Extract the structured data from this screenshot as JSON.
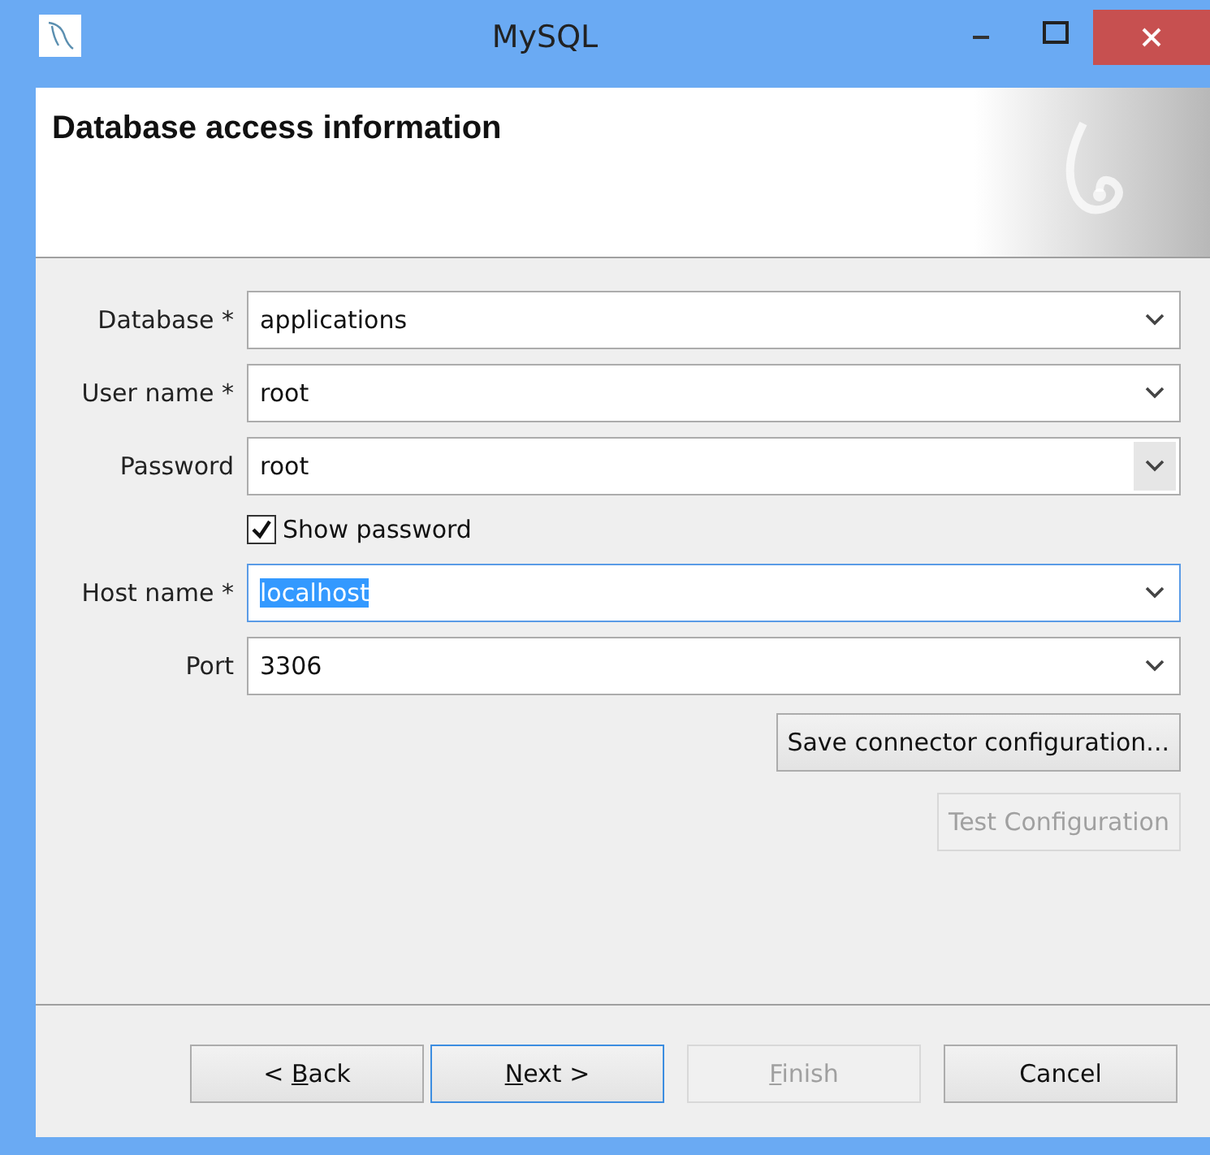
{
  "window": {
    "title": "MySQL"
  },
  "header": {
    "title": "Database access information"
  },
  "fields": [
    {
      "label": "Database *",
      "value": "applications",
      "focused": false,
      "arrow_shaded": false
    },
    {
      "label": "User name *",
      "value": "root",
      "focused": false,
      "arrow_shaded": false
    },
    {
      "label": "Password",
      "value": "root",
      "focused": false,
      "arrow_shaded": true
    },
    {
      "kind": "checkbox",
      "label": "Show password",
      "checked": true
    },
    {
      "label": "Host name *",
      "value": "localhost",
      "focused": true,
      "arrow_shaded": false
    },
    {
      "label": "Port",
      "value": "3306",
      "focused": false,
      "arrow_shaded": false
    }
  ],
  "actions": [
    {
      "label": "Save connector configuration...",
      "disabled": false
    },
    {
      "label": "Test Configuration",
      "disabled": true
    }
  ],
  "buttons": [
    {
      "before": "< ",
      "key": "B",
      "after": "ack",
      "disabled": false,
      "default": false
    },
    {
      "key": "N",
      "after": "ext >",
      "disabled": false,
      "default": true
    },
    {
      "key": "F",
      "after": "inish",
      "disabled": true,
      "default": false
    },
    {
      "before": "Cancel",
      "disabled": false,
      "default": false
    }
  ]
}
